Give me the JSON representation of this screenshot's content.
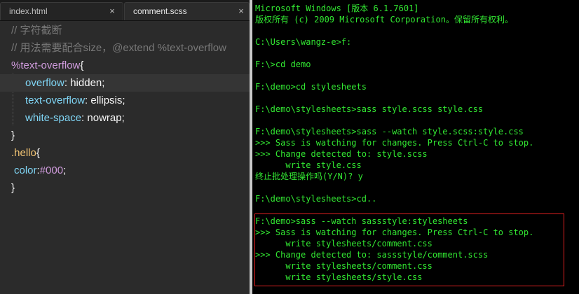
{
  "editor": {
    "tabs": [
      {
        "label": "index.html",
        "close": "×"
      },
      {
        "label": "comment.scss",
        "close": "×"
      }
    ],
    "lines": [
      {
        "t": "comment",
        "text": "// 字符截断"
      },
      {
        "t": "comment",
        "text": "// 用法需要配合size，@extend %text-overflow"
      },
      {
        "t": "placeholder",
        "sel": "%text-overflow",
        "brace": "{"
      },
      {
        "t": "decl",
        "prop": "overflow",
        "val": "hidden"
      },
      {
        "t": "decl",
        "prop": "text-overflow",
        "val": "ellipsis"
      },
      {
        "t": "decl",
        "prop": "white-space",
        "val": "nowrap"
      },
      {
        "t": "close",
        "text": "}"
      },
      {
        "t": "selector",
        "sel": ".hello",
        "brace": "{"
      },
      {
        "t": "colordecl",
        "prop": "color",
        "val": "#000"
      },
      {
        "t": "close",
        "text": "}"
      }
    ]
  },
  "console": {
    "lines": [
      "Microsoft Windows [版本 6.1.7601]",
      "版权所有 (c) 2009 Microsoft Corporation。保留所有权利。",
      "",
      "C:\\Users\\wangz-e>f:",
      "",
      "F:\\>cd demo",
      "",
      "F:\\demo>cd stylesheets",
      "",
      "F:\\demo\\stylesheets>sass style.scss style.css",
      "",
      "F:\\demo\\stylesheets>sass --watch style.scss:style.css",
      ">>> Sass is watching for changes. Press Ctrl-C to stop.",
      ">>> Change detected to: style.scss",
      "      write style.css",
      "终止批处理操作吗(Y/N)? y",
      "",
      "F:\\demo\\stylesheets>cd..",
      "",
      "F:\\demo>sass --watch sassstyle:stylesheets",
      ">>> Sass is watching for changes. Press Ctrl-C to stop.",
      "      write stylesheets/comment.css",
      ">>> Change detected to: sassstyle/comment.scss",
      "      write stylesheets/comment.css",
      "      write stylesheets/style.css"
    ]
  },
  "colors": {
    "console_text": "#32e832",
    "highlight_border": "#e02020"
  }
}
